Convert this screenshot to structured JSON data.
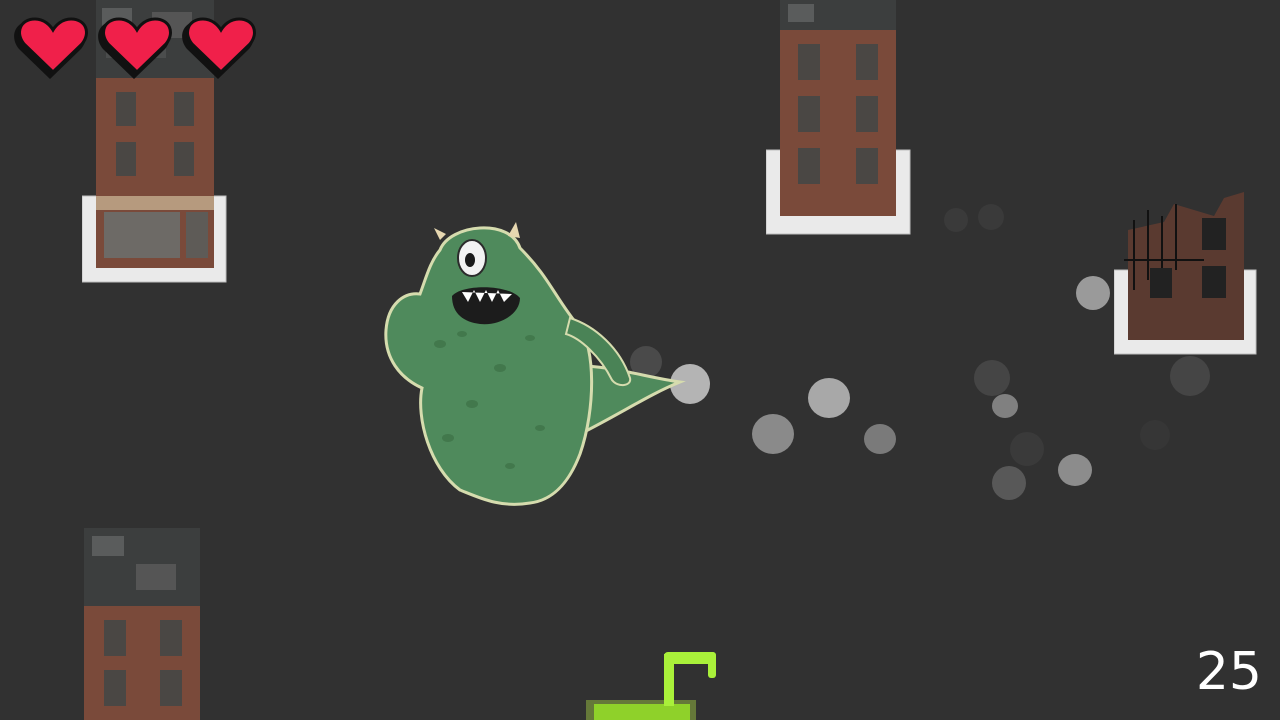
{
  "hud": {
    "lives": 3,
    "lives_max": 3,
    "score": "25"
  },
  "colors": {
    "background": "#313131",
    "heart": "#f0204a",
    "monster_green": "#4f8a5c",
    "brick": "#7a4a3a",
    "slime": "#a9f03a",
    "smoke": "#9a9a9a"
  },
  "entities": {
    "player": "one-eyed-green-monster",
    "powerup": "green-slime-tower"
  }
}
